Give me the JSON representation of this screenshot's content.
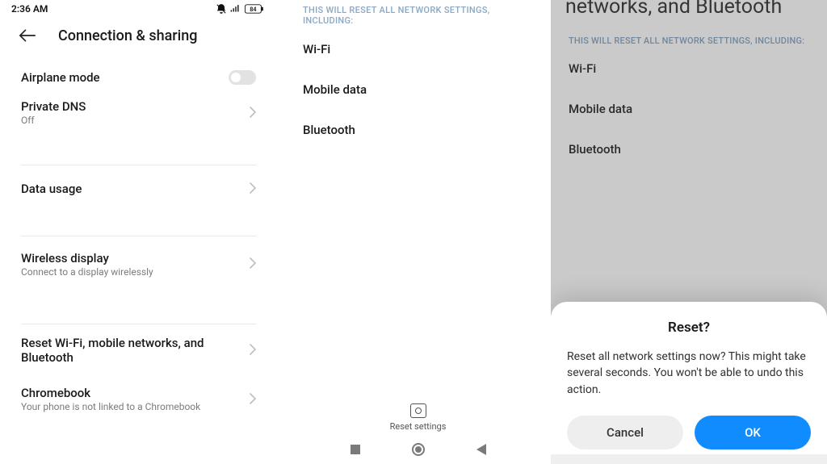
{
  "pane1": {
    "status": {
      "time": "2:36 AM",
      "battery": "84"
    },
    "title": "Connection & sharing",
    "rows": {
      "airplane": {
        "title": "Airplane mode"
      },
      "dns": {
        "title": "Private DNS",
        "sub": "Off"
      },
      "data": {
        "title": "Data usage"
      },
      "wdisp": {
        "title": "Wireless display",
        "sub": "Connect to a display wirelessly"
      },
      "reset": {
        "title": "Reset Wi-Fi, mobile networks, and Bluetooth"
      },
      "chrome": {
        "title": "Chromebook",
        "sub": "Your phone is not linked to a Chromebook"
      }
    }
  },
  "pane2": {
    "caption": "THIS WILL RESET ALL NETWORK SETTINGS, INCLUDING:",
    "items": [
      "Wi-Fi",
      "Mobile data",
      "Bluetooth"
    ],
    "reset_button": "Reset settings"
  },
  "pane3": {
    "header_title": "networks, and Bluetooth",
    "caption": "THIS WILL RESET ALL NETWORK SETTINGS, INCLUDING:",
    "items": [
      "Wi-Fi",
      "Mobile data",
      "Bluetooth"
    ],
    "dialog": {
      "title": "Reset?",
      "message": "Reset all network settings now? This might take several seconds. You won't be able to undo this action.",
      "cancel": "Cancel",
      "ok": "OK"
    }
  }
}
